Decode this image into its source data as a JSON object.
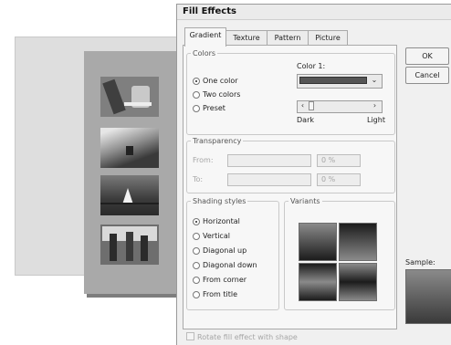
{
  "dialog": {
    "title": "Fill Effects",
    "tabs": [
      {
        "label": "Gradient",
        "active": true
      },
      {
        "label": "Texture",
        "active": false
      },
      {
        "label": "Pattern",
        "active": false
      },
      {
        "label": "Picture",
        "active": false
      }
    ],
    "ok_label": "OK",
    "cancel_label": "Cancel",
    "colors_group": {
      "legend": "Colors",
      "options": [
        "One color",
        "Two colors",
        "Preset"
      ],
      "selected": "One color",
      "color1_label": "Color 1:",
      "color1_value": "#555555",
      "dark_label": "Dark",
      "light_label": "Light"
    },
    "transparency_group": {
      "legend": "Transparency",
      "from_label": "From:",
      "from_value": "0 %",
      "to_label": "To:",
      "to_value": "0 %"
    },
    "shading_group": {
      "legend": "Shading styles",
      "options": [
        "Horizontal",
        "Vertical",
        "Diagonal up",
        "Diagonal down",
        "From corner",
        "From title"
      ],
      "selected": "Horizontal"
    },
    "variants_legend": "Variants",
    "sample_label": "Sample:",
    "rotate_checkbox_label": "Rotate fill effect with shape"
  },
  "colors": {
    "gradient_dark": "#3a3a3a",
    "gradient_light": "#8a8a8a"
  }
}
